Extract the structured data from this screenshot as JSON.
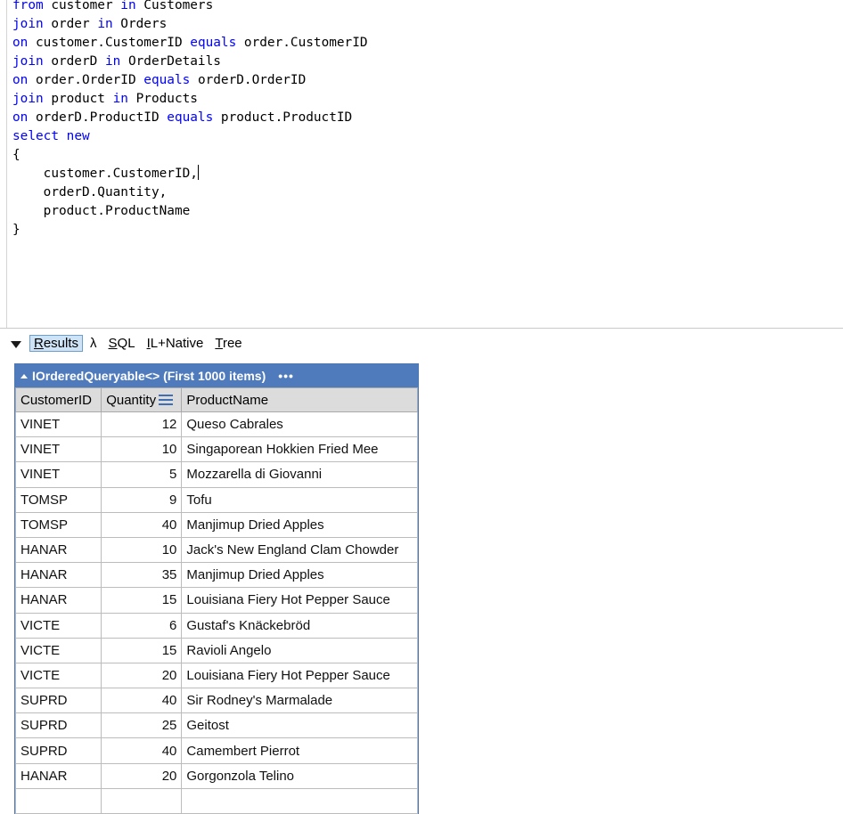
{
  "editor": {
    "lines": [
      [
        {
          "t": "from",
          "k": true
        },
        {
          "t": " customer "
        },
        {
          "t": "in",
          "k": true
        },
        {
          "t": " Customers"
        }
      ],
      [
        {
          "t": "join",
          "k": true
        },
        {
          "t": " order "
        },
        {
          "t": "in",
          "k": true
        },
        {
          "t": " Orders"
        }
      ],
      [
        {
          "t": "on",
          "k": true
        },
        {
          "t": " customer.CustomerID "
        },
        {
          "t": "equals",
          "k": true
        },
        {
          "t": " order.CustomerID"
        }
      ],
      [
        {
          "t": "join",
          "k": true
        },
        {
          "t": " orderD "
        },
        {
          "t": "in",
          "k": true
        },
        {
          "t": " OrderDetails"
        }
      ],
      [
        {
          "t": "on",
          "k": true
        },
        {
          "t": " order.OrderID "
        },
        {
          "t": "equals",
          "k": true
        },
        {
          "t": " orderD.OrderID"
        }
      ],
      [
        {
          "t": "join",
          "k": true
        },
        {
          "t": " product "
        },
        {
          "t": "in",
          "k": true
        },
        {
          "t": " Products"
        }
      ],
      [
        {
          "t": "on",
          "k": true
        },
        {
          "t": " orderD.ProductID "
        },
        {
          "t": "equals",
          "k": true
        },
        {
          "t": " product.ProductID"
        }
      ],
      [
        {
          "t": "select",
          "k": true
        },
        {
          "t": " "
        },
        {
          "t": "new",
          "k": true
        }
      ],
      [
        {
          "t": "{"
        }
      ],
      [
        {
          "t": "    customer.CustomerID,"
        },
        {
          "caret": true
        }
      ],
      [
        {
          "t": "    orderD.Quantity,"
        }
      ],
      [
        {
          "t": "    product.ProductName"
        }
      ],
      [
        {
          "t": "}"
        }
      ]
    ]
  },
  "toolbar": {
    "tabs": [
      {
        "label": "Results",
        "name": "tab-results",
        "active": true
      },
      {
        "label": "λ",
        "name": "tab-lambda",
        "active": false
      },
      {
        "label": "SQL",
        "name": "tab-sql",
        "active": false
      },
      {
        "label": "IL+Native",
        "name": "tab-il-native",
        "active": false
      },
      {
        "label": "Tree",
        "name": "tab-tree",
        "active": false
      }
    ]
  },
  "results": {
    "title": "IOrderedQueryable<> (First 1000 items)",
    "more": "•••",
    "columns": [
      "CustomerID",
      "Quantity",
      "ProductName"
    ],
    "rows": [
      [
        "VINET",
        "12",
        "Queso Cabrales"
      ],
      [
        "VINET",
        "10",
        "Singaporean Hokkien Fried Mee"
      ],
      [
        "VINET",
        "5",
        "Mozzarella di Giovanni"
      ],
      [
        "TOMSP",
        "9",
        "Tofu"
      ],
      [
        "TOMSP",
        "40",
        "Manjimup Dried Apples"
      ],
      [
        "HANAR",
        "10",
        "Jack's New England Clam Chowder"
      ],
      [
        "HANAR",
        "35",
        "Manjimup Dried Apples"
      ],
      [
        "HANAR",
        "15",
        "Louisiana Fiery Hot Pepper Sauce"
      ],
      [
        "VICTE",
        "6",
        "Gustaf's Knäckebröd"
      ],
      [
        "VICTE",
        "15",
        "Ravioli Angelo"
      ],
      [
        "VICTE",
        "20",
        "Louisiana Fiery Hot Pepper Sauce"
      ],
      [
        "SUPRD",
        "40",
        "Sir Rodney's Marmalade"
      ],
      [
        "SUPRD",
        "25",
        "Geitost"
      ],
      [
        "SUPRD",
        "40",
        "Camembert Pierrot"
      ],
      [
        "HANAR",
        "20",
        "Gorgonzola Telino"
      ],
      [
        "",
        "",
        ""
      ]
    ]
  }
}
